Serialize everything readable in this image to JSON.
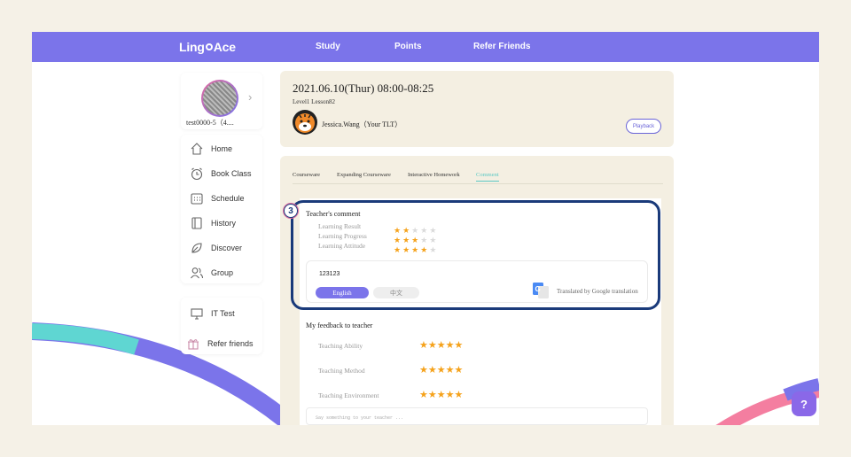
{
  "header": {
    "logo_left": "Ling",
    "logo_right": "Ace",
    "nav": [
      "Study",
      "Points",
      "Refer Friends"
    ]
  },
  "profile": {
    "name": "test0000-5（4...."
  },
  "sidebar": {
    "items": [
      {
        "label": "Home",
        "icon": "home-icon"
      },
      {
        "label": "Book Class",
        "icon": "clock-icon"
      },
      {
        "label": "Schedule",
        "icon": "calendar-icon"
      },
      {
        "label": "History",
        "icon": "book-icon"
      },
      {
        "label": "Discover",
        "icon": "leaf-icon"
      },
      {
        "label": "Group",
        "icon": "users-icon"
      }
    ],
    "extra": [
      {
        "label": "IT Test",
        "icon": "monitor-icon"
      },
      {
        "label": "Refer friends",
        "icon": "gift-icon"
      }
    ]
  },
  "lesson": {
    "datetime": "2021.06.10(Thur) 08:00-08:25",
    "name": "Level1 Lesson82",
    "teacher": "Jessica.Wang（Your TLT）",
    "playback_label": "Playback"
  },
  "tabs": [
    "Courseware",
    "Expanding Courseware",
    "Interactive Homework",
    "Comment"
  ],
  "active_tab": "Comment",
  "step_badge": "3",
  "teacher_comment": {
    "title": "Teacher's comment",
    "ratings": [
      {
        "label": "Learning Result",
        "value": 2
      },
      {
        "label": "Learning Progress",
        "value": 3
      },
      {
        "label": "Learning Attitude",
        "value": 4
      }
    ],
    "max": 5,
    "text": "123123",
    "lang_en": "English",
    "lang_zh": "中文",
    "translated": "Translated by Google translation"
  },
  "feedback": {
    "title": "My feedback to teacher",
    "ratings": [
      {
        "label": "Teaching Ability",
        "value": 5
      },
      {
        "label": "Teaching Method",
        "value": 5
      },
      {
        "label": "Teaching Environment",
        "value": 5
      }
    ],
    "placeholder": "Say something to your teacher ..."
  },
  "help_label": "?",
  "colors": {
    "brand": "#7b74ea",
    "accent_teal": "#5cc9c4",
    "star": "#f5a21b",
    "highlight_border": "#1a3a7a"
  }
}
